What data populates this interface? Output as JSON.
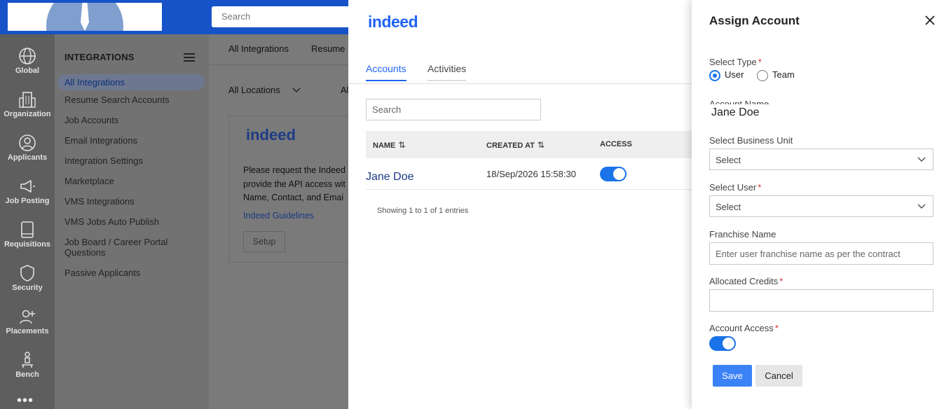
{
  "header": {
    "search_placeholder": "Search"
  },
  "rail": {
    "items": [
      {
        "label": "Global",
        "icon": "globe-icon"
      },
      {
        "label": "Organization",
        "icon": "building-icon"
      },
      {
        "label": "Applicants",
        "icon": "user-circle-icon"
      },
      {
        "label": "Job Posting",
        "icon": "megaphone-icon"
      },
      {
        "label": "Requisitions",
        "icon": "book-icon"
      },
      {
        "label": "Security",
        "icon": "shield-icon"
      },
      {
        "label": "Placements",
        "icon": "user-plus-icon"
      },
      {
        "label": "Bench",
        "icon": "person-bench-icon"
      }
    ],
    "more": "•••"
  },
  "menu": {
    "title": "INTEGRATIONS",
    "items": [
      "All Integrations",
      "Resume Search Accounts",
      "Job Accounts",
      "Email Integrations",
      "Integration Settings",
      "Marketplace",
      "VMS Integrations",
      "VMS Jobs Auto Publish",
      "Job Board / Career Portal Questions",
      "Passive Applicants"
    ]
  },
  "main": {
    "tabs": [
      "All Integrations",
      "Resume S"
    ],
    "filters": [
      "All Locations",
      "Al"
    ],
    "card": {
      "logo": "indeed",
      "text_lines": [
        "Please request the Indeed",
        "provide the API access wit",
        "Name, Contact, and Emai"
      ],
      "link": "Indeed Guidelines",
      "button": "Setup"
    }
  },
  "panel": {
    "logo": "indeed",
    "tabs": [
      "Accounts",
      "Activities"
    ],
    "search_placeholder": "Search",
    "columns": [
      "NAME",
      "CREATED AT",
      "ACCESS"
    ],
    "rows": [
      {
        "name": "Jane Doe",
        "created_at": "18/Sep/2026 15:58:30",
        "access": true
      }
    ],
    "footer": "Showing 1 to 1 of 1 entries"
  },
  "drawer": {
    "title": "Assign Account",
    "select_type_label": "Select Type",
    "type_options": [
      "User",
      "Team"
    ],
    "type_selected": "User",
    "account_name_label": "Account Name",
    "account_name_value": "Jane Doe",
    "business_unit_label": "Select Business Unit",
    "business_unit_value": "Select",
    "user_label": "Select User",
    "user_value": "Select",
    "franchise_label": "Franchise Name",
    "franchise_placeholder": "Enter user franchise name as per the contract",
    "credits_label": "Allocated Credits",
    "credits_value": "",
    "access_label": "Account Access",
    "access_enabled": true,
    "save": "Save",
    "cancel": "Cancel",
    "required_mark": "*"
  },
  "colors": {
    "brand_blue": "#1753c8",
    "accent": "#1a73e8",
    "indeed_blue": "#2164f3",
    "required": "#d32f2f"
  }
}
